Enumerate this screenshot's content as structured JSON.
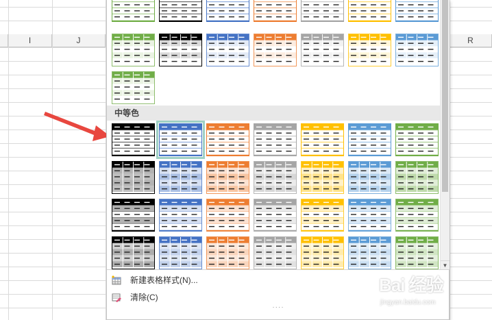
{
  "sheet": {
    "columns": [
      {
        "label": "I"
      },
      {
        "label": "J"
      },
      {
        "label": "R"
      }
    ]
  },
  "gallery": {
    "sections": [
      {
        "title": "中等色"
      }
    ],
    "light_rows": [
      [
        "#70ad47",
        "#000000",
        "#4472c4",
        "#ed7d31",
        "#a5a5a5",
        "#ffc000",
        "#5b9bd5"
      ],
      [
        "#70ad47",
        "#000000",
        "#4472c4",
        "#ed7d31",
        "#a5a5a5",
        "#ffc000",
        "#5b9bd5"
      ],
      [
        "#70ad47"
      ]
    ],
    "medium_rows": [
      [
        "#000000",
        "#4472c4",
        "#ed7d31",
        "#a5a5a5",
        "#ffc000",
        "#5b9bd5",
        "#70ad47"
      ],
      [
        "#000000",
        "#4472c4",
        "#ed7d31",
        "#a5a5a5",
        "#ffc000",
        "#5b9bd5",
        "#70ad47"
      ],
      [
        "#000000",
        "#4472c4",
        "#ed7d31",
        "#a5a5a5",
        "#ffc000",
        "#5b9bd5",
        "#70ad47"
      ],
      [
        "#000000",
        "#4472c4",
        "#ed7d31",
        "#a5a5a5",
        "#ffc000",
        "#5b9bd5",
        "#70ad47"
      ]
    ],
    "selected_style": "medium-row-1-col-2"
  },
  "menu": {
    "new_style": "新建表格样式(N)...",
    "clear": "清除(C)"
  },
  "annotation": {
    "arrow_color": "#e8473f"
  },
  "watermark": {
    "logo": "Bai 经验",
    "url": "jingyan.baidu.com"
  },
  "icons": {
    "new_style": "table-style-new-icon",
    "clear": "eraser-icon",
    "scroll_down": "scroll-down-arrow-icon"
  }
}
